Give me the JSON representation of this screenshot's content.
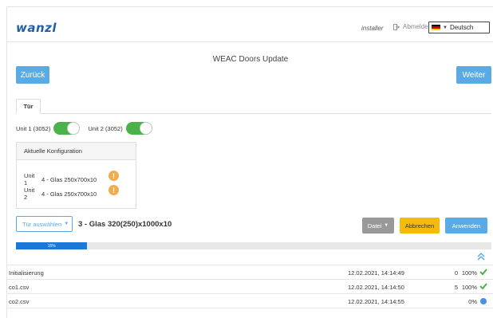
{
  "header": {
    "logo": "wanzl",
    "user": "installer",
    "logout_label": "Abmelden",
    "language": "Deutsch"
  },
  "page": {
    "title": "WEAC Doors Update",
    "back_label": "Zurück",
    "next_label": "Weiter"
  },
  "tabs": [
    {
      "label": "Tür",
      "active": true
    }
  ],
  "units": [
    {
      "label": "Unit 1 (3052)",
      "enabled": true
    },
    {
      "label": "Unit 2 (3052)",
      "enabled": true
    }
  ],
  "config": {
    "title": "Aktuelle Konfiguration",
    "rows": [
      {
        "unit": "Unit 1",
        "value": "4 - Glas 250x700x10",
        "warning": true
      },
      {
        "unit": "Unit 2",
        "value": "4 - Glas 250x700x10",
        "warning": true
      }
    ]
  },
  "door": {
    "select_label": "Tür auswählen",
    "selected": "3 - Glas 320(250)x1000x10"
  },
  "actions": {
    "file_label": "Datei",
    "cancel_label": "Abbrechen",
    "apply_label": "Anwenden"
  },
  "progress": {
    "percent": 15,
    "label": "15%"
  },
  "log": [
    {
      "name": "Initialisierung",
      "time": "12.02.2021, 14:14:49",
      "count": "0",
      "percent": "100%",
      "status": "done"
    },
    {
      "name": "co1.csv",
      "time": "12.02.2021, 14:14:50",
      "count": "5",
      "percent": "100%",
      "status": "done"
    },
    {
      "name": "co2.csv",
      "time": "12.02.2021, 14:14:55",
      "count": "",
      "percent": "0%",
      "status": "pending"
    }
  ],
  "colors": {
    "primary": "#5aaae5",
    "success": "#49b24a",
    "warning": "#f0ad4e",
    "cancel": "#f5bb0c",
    "progress": "#1a78d8"
  },
  "icons": {
    "logout": "sign-out-icon",
    "collapse": "double-chevron-up-icon",
    "done": "check-icon",
    "pending": "dot-icon",
    "warning": "exclamation-icon"
  }
}
